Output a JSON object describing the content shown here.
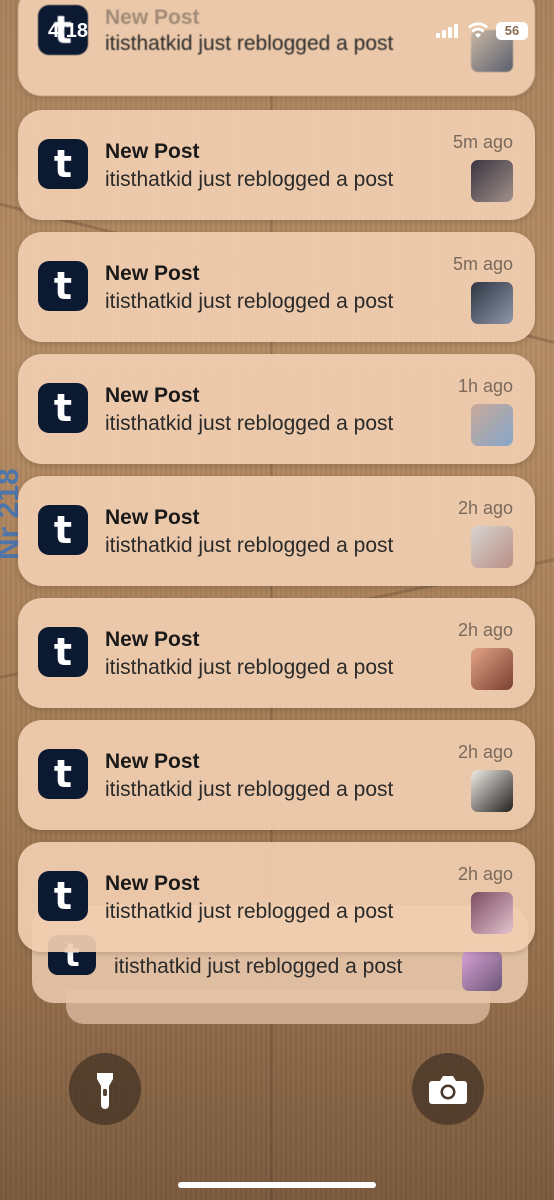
{
  "status_bar": {
    "time": "4:18",
    "battery": "56"
  },
  "notifications": [
    {
      "app": "tumblr",
      "title": "New Post",
      "body": "itisthatkid just reblogged a post",
      "time": "",
      "thumb_colors": [
        "#c9b7a6",
        "#5a5f6d"
      ]
    },
    {
      "app": "tumblr",
      "title": "New Post",
      "body": "itisthatkid just reblogged a post",
      "time": "5m ago",
      "thumb_colors": [
        "#3b3541",
        "#a18f8a"
      ]
    },
    {
      "app": "tumblr",
      "title": "New Post",
      "body": "itisthatkid just reblogged a post",
      "time": "5m ago",
      "thumb_colors": [
        "#2e3644",
        "#8f96a8"
      ]
    },
    {
      "app": "tumblr",
      "title": "New Post",
      "body": "itisthatkid just reblogged a post",
      "time": "1h ago",
      "thumb_colors": [
        "#c8a99a",
        "#86a6c9"
      ]
    },
    {
      "app": "tumblr",
      "title": "New Post",
      "body": "itisthatkid just reblogged a post",
      "time": "2h ago",
      "thumb_colors": [
        "#d9d4d0",
        "#b98e86"
      ]
    },
    {
      "app": "tumblr",
      "title": "New Post",
      "body": "itisthatkid just reblogged a post",
      "time": "2h ago",
      "thumb_colors": [
        "#e2a487",
        "#7a3f2f"
      ]
    },
    {
      "app": "tumblr",
      "title": "New Post",
      "body": "itisthatkid just reblogged a post",
      "time": "2h ago",
      "thumb_colors": [
        "#f1ece7",
        "#23211f"
      ]
    },
    {
      "app": "tumblr",
      "title": "New Post",
      "body": "itisthatkid just reblogged a post",
      "time": "2h ago",
      "thumb_colors": [
        "#7c4c61",
        "#e3c3ce"
      ]
    }
  ],
  "stacked": {
    "body": "itisthatkid just reblogged a post",
    "thumb_colors": [
      "#d9a3d7",
      "#6a5476"
    ]
  },
  "icons": {
    "app_icon": "tumblr-icon",
    "flashlight": "flashlight-icon",
    "camera": "camera-icon"
  },
  "background_print": "Nr 218",
  "colors": {
    "card": "#f0cdaf",
    "app_icon_bg": "#0b1931"
  }
}
